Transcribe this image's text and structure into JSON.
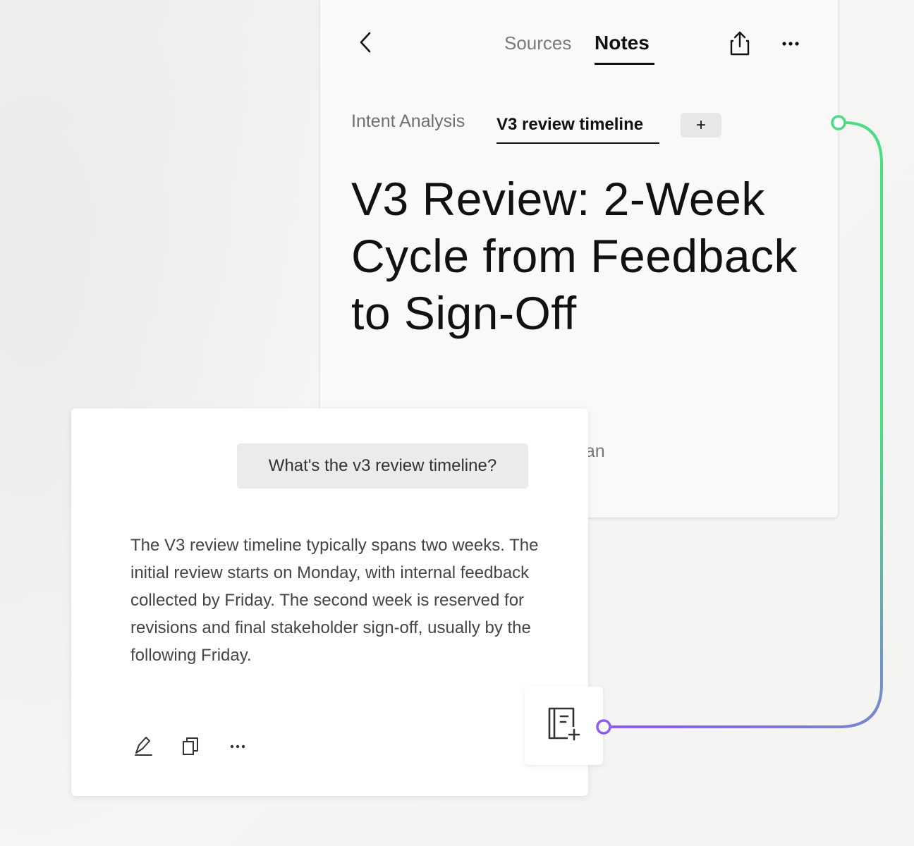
{
  "header": {
    "tabs": [
      {
        "label": "Sources",
        "active": false
      },
      {
        "label": "Notes",
        "active": true
      }
    ],
    "icons": {
      "back": "chevron-left-icon",
      "share": "share-icon",
      "more": "more-horizontal-icon"
    }
  },
  "note_tabs": [
    {
      "label": "Intent Analysis",
      "active": false
    },
    {
      "label": "V3 review timeline",
      "active": true
    }
  ],
  "add_tab_label": "+",
  "note": {
    "title": "V3 Review: 2-Week Cycle from Feedback to Sign-Off",
    "obscured_text": "rian"
  },
  "chat": {
    "user_message": "What's the v3 review timeline?",
    "answer": "The V3 review timeline typically spans two weeks. The initial review starts on Monday, with internal feedback collected by Friday. The second week is reserved for revisions and final stakeholder sign-off, usually by the following Friday.",
    "actions": [
      "edit-icon",
      "copy-icon",
      "more-horizontal-icon"
    ]
  },
  "add_note_button": {
    "icon": "add-to-notes-icon"
  },
  "colors": {
    "connector_start": "#8b5cf6",
    "connector_end": "#4ade80",
    "background": "#f4f4f3"
  }
}
